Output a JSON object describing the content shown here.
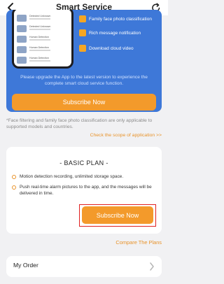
{
  "header": {
    "title": "Smart Service",
    "back_icon": "chevron-left-icon",
    "refresh_icon": "refresh-icon"
  },
  "promo": {
    "phone_rows": [
      {
        "label": "Detected Unknown"
      },
      {
        "label": "Detected Unknown"
      },
      {
        "label": "Human Detection"
      },
      {
        "label": "Human Detection"
      },
      {
        "label": "Human Detection"
      }
    ],
    "features": [
      {
        "icon": "face-photo-icon",
        "label": "Family face photo classification"
      },
      {
        "icon": "message-icon",
        "label": "Rich message notification"
      },
      {
        "icon": "cloud-download-icon",
        "label": "Download cloud video"
      }
    ],
    "upgrade_text": "Please upgrade the App to the latest version to experience the complete smart cloud service function.",
    "subscribe_label": "Subscribe Now"
  },
  "note": "*Face filtering and family face photo classification are only applicable to supported models and countries.",
  "scope_link": "Check the scope of application >>",
  "plan": {
    "title": "- BASIC PLAN -",
    "items": [
      "Motion detection recording, unlimited storage space.",
      "Push real-time alarm pictures to the app, and the messages will be delivered in time."
    ],
    "subscribe_label": "Subscribe Now"
  },
  "compare_link": "Compare The Plans",
  "order": {
    "label": "My Order"
  },
  "colors": {
    "accent_orange": "#f39a2b",
    "promo_blue": "#3e78d8",
    "highlight_red": "#e02020"
  }
}
